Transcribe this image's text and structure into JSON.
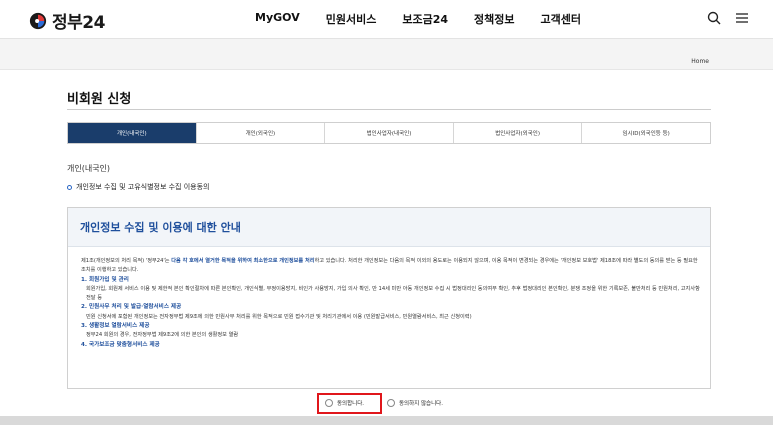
{
  "header": {
    "logo_text": "정부24",
    "nav": [
      "MyGOV",
      "민원서비스",
      "보조금24",
      "정책정보",
      "고객센터"
    ],
    "icons": [
      "search-icon",
      "menu-icon"
    ]
  },
  "breadcrumb": {
    "home": "Home"
  },
  "page_title": "비회원 신청",
  "tabs": [
    {
      "label": "개인(내국인)",
      "active": true
    },
    {
      "label": "개인(외국인)",
      "active": false
    },
    {
      "label": "법인사업자(내국인)",
      "active": false
    },
    {
      "label": "법인사업자(외국인)",
      "active": false
    },
    {
      "label": "임시ID(외국인등 등)",
      "active": false
    }
  ],
  "section_label": "개인(내국인)",
  "consent_heading": "개인정보 수집 및 고유식별정보 수집 이용동의",
  "notice": {
    "title": "개인정보 수집 및 이용에 대한 안내",
    "intro_a": "제1조(개인정보의 처리 목적) '정부24'는 ",
    "intro_hl": "다음 각 호에서 열거한 목적을 위하여 최소한으로 개인정보를 처리",
    "intro_b": "하고 있습니다. 처리한 개인정보는 다음의 목적 이외의 용도로는 이용되지 않으며, 이용 목적이 변경되는 경우에는 '개인정보 보호법' 제18조에 따라 별도의 동의를 받는 등 필요한 조치를 이행하고 있습니다.",
    "items": [
      {
        "heading": "1. 회원가입 및 관리",
        "text": "회원가입, 회원제 서비스 이용 및 제한적 본인 확인절차에 따른 본인확인, 개인식별, 부정이용방지, 비인가 사용방지, 가입 의사 확인, 만 14세 미만 아동 개인정보 수집 시 법정대리인 동의여부 확인, 추후 법정대리인 본인확인, 분쟁 조정을 위한 기록보존, 불만처리 등 민원처리, 고지사항 전달 등"
      },
      {
        "heading": "2. 민원사무 처리 및 발급·열람서비스 제공",
        "text": "민원 신청서에 포함된 개인정보는 전자정부법 제9조에 의한 민원사무 처리를 위한 목적으로 민원 접수기관 및 처리기관에서 이용 (민원발급서비스, 민원열람서비스, 최근 신청이력)"
      },
      {
        "heading": "3. 생활정보 열람서비스 제공",
        "text": "정부24 회원의 경우, 전자정부법 제9조2에 의한 본인의 생활정보 열람"
      },
      {
        "heading": "4. 국가보조금 맞춤형서비스 제공",
        "text": ""
      }
    ]
  },
  "agree": {
    "yes_label": "동의합니다.",
    "no_label": "동의하지 않습니다.",
    "selected": "none"
  },
  "colors": {
    "accent": "#1f4f9c",
    "tab_active": "#1a3d6b",
    "highlight_box": "#e0161b"
  }
}
